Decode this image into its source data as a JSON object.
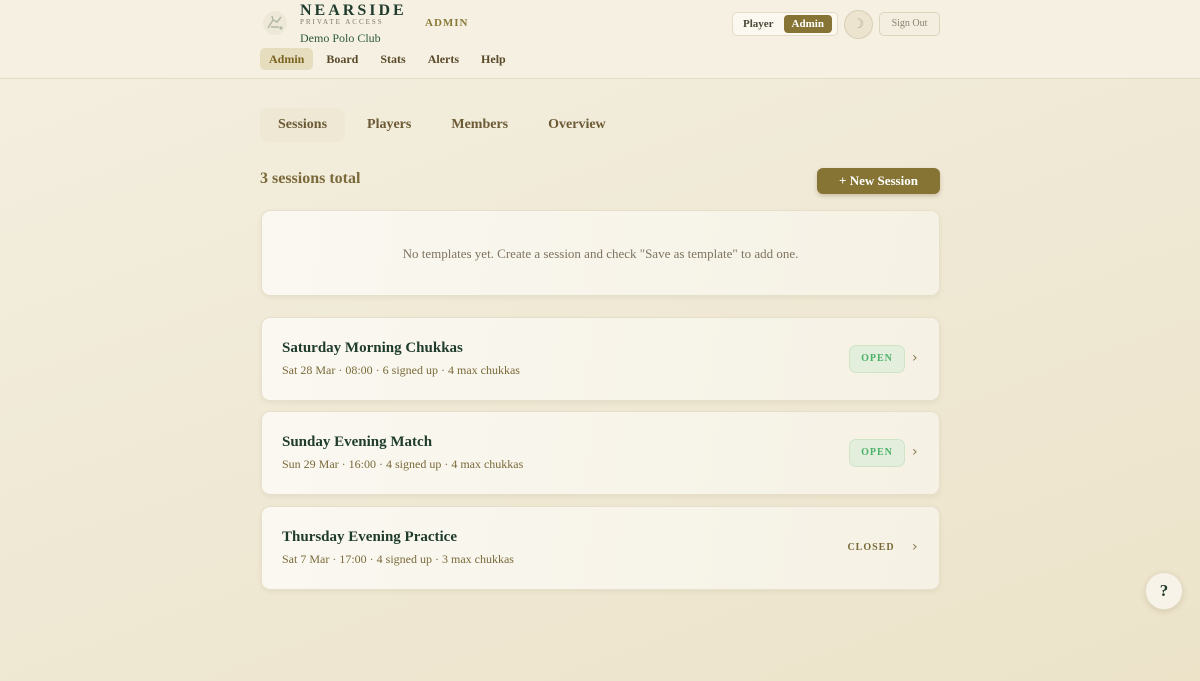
{
  "brand": {
    "name": "NEARSIDE",
    "tagline": "PRIVATE ACCESS",
    "club": "Demo Polo Club",
    "role": "ADMIN"
  },
  "header": {
    "view_toggle": {
      "options": [
        "Player",
        "Admin"
      ],
      "selected": "Admin"
    },
    "theme_icon": "moon-icon",
    "signout_label": "Sign Out"
  },
  "nav": {
    "items": [
      {
        "label": "Admin",
        "active": true
      },
      {
        "label": "Board",
        "active": false
      },
      {
        "label": "Stats",
        "active": false
      },
      {
        "label": "Alerts",
        "active": false
      },
      {
        "label": "Help",
        "active": false
      }
    ]
  },
  "tabs": {
    "items": [
      {
        "label": "Sessions",
        "active": true
      },
      {
        "label": "Players",
        "active": false
      },
      {
        "label": "Members",
        "active": false
      },
      {
        "label": "Overview",
        "active": false
      }
    ]
  },
  "sessions": {
    "count_label": "3 sessions total",
    "new_button": "+ New Session",
    "templates_empty": "No templates yet. Create a session and check \"Save as template\" to add one.",
    "items": [
      {
        "title": "Saturday Morning Chukkas",
        "meta": "Sat 28 Mar · 08:00 · 6 signed up · 4 max chukkas",
        "status": "OPEN"
      },
      {
        "title": "Sunday Evening Match",
        "meta": "Sun 29 Mar · 16:00 · 4 signed up · 4 max chukkas",
        "status": "OPEN"
      },
      {
        "title": "Thursday Evening Practice",
        "meta": "Sat 7 Mar · 17:00 · 4 signed up · 3 max chukkas",
        "status": "CLOSED"
      }
    ]
  },
  "help_button": "?",
  "colors": {
    "accent": "#857433",
    "open_status": "#4cb26a",
    "heading": "#1f3b2c"
  }
}
